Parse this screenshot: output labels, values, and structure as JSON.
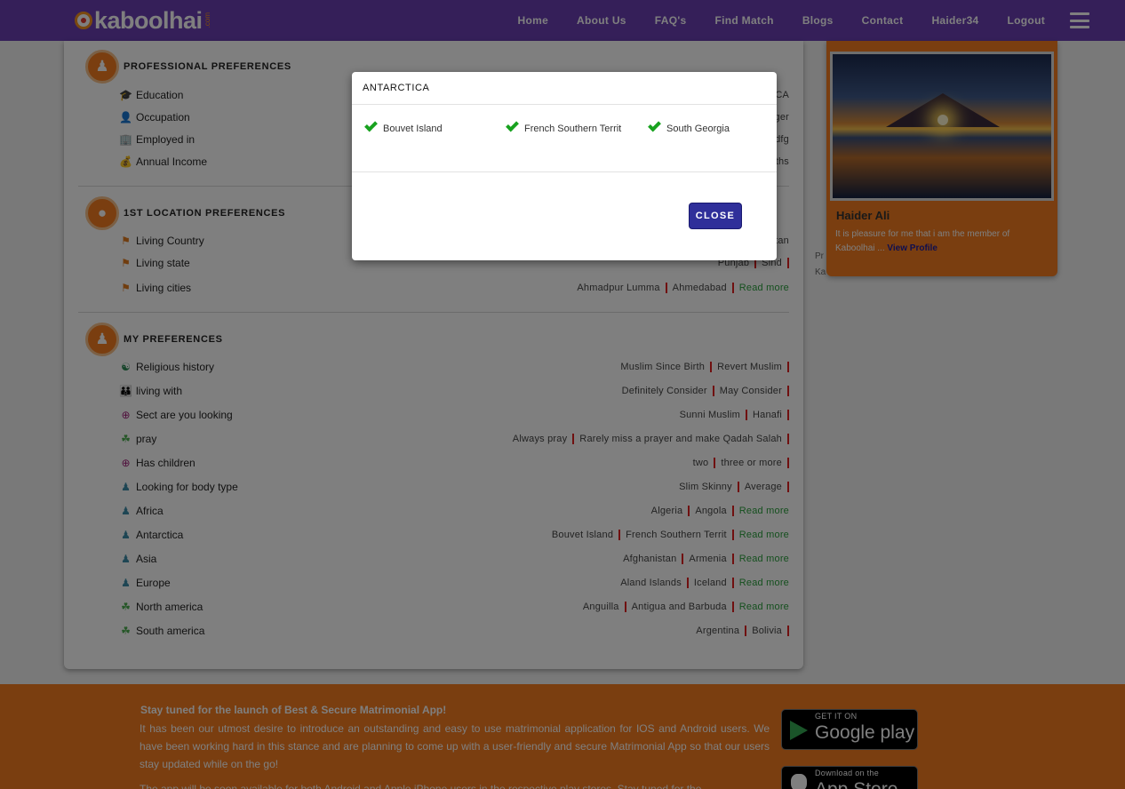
{
  "brand": {
    "name": "kaboolhai",
    "suffix": ".com"
  },
  "nav": {
    "links": [
      "Home",
      "About Us",
      "FAQ's",
      "Find Match",
      "Blogs",
      "Contact",
      "Haider34",
      "Logout"
    ]
  },
  "professional": {
    "title": "PROFESSIONAL PREFERENCES",
    "rows": [
      {
        "label": "Education",
        "icon": "graduation-cap-icon",
        "tail": "CA"
      },
      {
        "label": "Occupation",
        "icon": "person-icon",
        "tail": "ger"
      },
      {
        "label": "Employed in",
        "icon": "building-icon",
        "tail": "dfg"
      },
      {
        "label": "Annual Income",
        "icon": "money-hand-icon",
        "tail": "ths"
      }
    ]
  },
  "location": {
    "title": "1ST LOCATION PREFERENCES",
    "rows": [
      {
        "label": "Living Country",
        "icon": "flag-icon",
        "tail": "tan"
      },
      {
        "label": "Living state",
        "icon": "flag-icon",
        "values": [
          "Punjab",
          "Sind"
        ]
      },
      {
        "label": "Living cities",
        "icon": "flag-icon",
        "values": [
          "Ahmadpur Lumma",
          "Ahmedabad"
        ],
        "more": "Read more"
      }
    ]
  },
  "my_prefs": {
    "title": "MY PREFERENCES",
    "rows": [
      {
        "label": "Religious history",
        "icon": "religion-icon",
        "values": [
          "Muslim Since Birth",
          "Revert Muslim"
        ]
      },
      {
        "label": "living with",
        "icon": "family-icon",
        "values": [
          "Definitely Consider",
          "May Consider"
        ]
      },
      {
        "label": "Sect are you looking",
        "icon": "crosshair-icon",
        "values": [
          "Sunni Muslim",
          "Hanafi"
        ]
      },
      {
        "label": "pray",
        "icon": "prayer-icon",
        "values": [
          "Always pray",
          "Rarely miss a prayer and make Qadah Salah"
        ]
      },
      {
        "label": "Has children",
        "icon": "crosshair-icon",
        "values": [
          "two",
          "three or more"
        ]
      },
      {
        "label": "Looking for body type",
        "icon": "people-icon",
        "values": [
          "Slim Skinny",
          "Average"
        ]
      },
      {
        "label": "Africa",
        "icon": "people-icon",
        "values": [
          "Algeria",
          "Angola"
        ],
        "more": "Read more"
      },
      {
        "label": "Antarctica",
        "icon": "people-icon",
        "values": [
          "Bouvet Island",
          "French Southern Territ"
        ],
        "more": "Read more"
      },
      {
        "label": "Asia",
        "icon": "people-icon",
        "values": [
          "Afghanistan",
          "Armenia"
        ],
        "more": "Read more"
      },
      {
        "label": "Europe",
        "icon": "people-icon",
        "values": [
          "Aland Islands",
          "Iceland"
        ],
        "more": "Read more"
      },
      {
        "label": "North america",
        "icon": "prayer-icon",
        "values": [
          "Anguilla",
          "Antigua and Barbuda"
        ],
        "more": "Read more"
      },
      {
        "label": "South america",
        "icon": "prayer-icon",
        "values": [
          "Argentina",
          "Bolivia"
        ]
      }
    ]
  },
  "sidebar": {
    "name": "Haider Ali",
    "desc": "It is pleasure for me that i am the member of Kaboolhai ...",
    "link": "View Profile",
    "frag1": "Pr",
    "frag2": "Ka"
  },
  "footer": {
    "title": "Stay tuned for the launch of Best & Secure Matrimonial App!",
    "body": "It has been our utmost desire to introduce an outstanding and easy to use matrimonial application for IOS and Android users. We have been working hard in this stance and are planning to come up with a user-friendly and secure Matrimonial App so that our users stay updated while on the go!",
    "body2": "The app will be soon available for both Android and Apple iPhone users in the respective play stores. Stay tuned for the",
    "google": {
      "small": "GET IT ON",
      "big": "Google play"
    },
    "apple": {
      "small": "Download on the",
      "big": "App Store"
    }
  },
  "modal": {
    "title": "ANTARCTICA",
    "items": [
      "Bouvet Island",
      "French Southern Territ",
      "South Georgia"
    ],
    "close": "CLOSE"
  },
  "colors": {
    "nav": "#6a3fb3",
    "accent": "#f47c20",
    "button": "#2f2f9a",
    "check": "#18a21f",
    "read_more": "#2aa03d",
    "separator": "#e02020"
  }
}
